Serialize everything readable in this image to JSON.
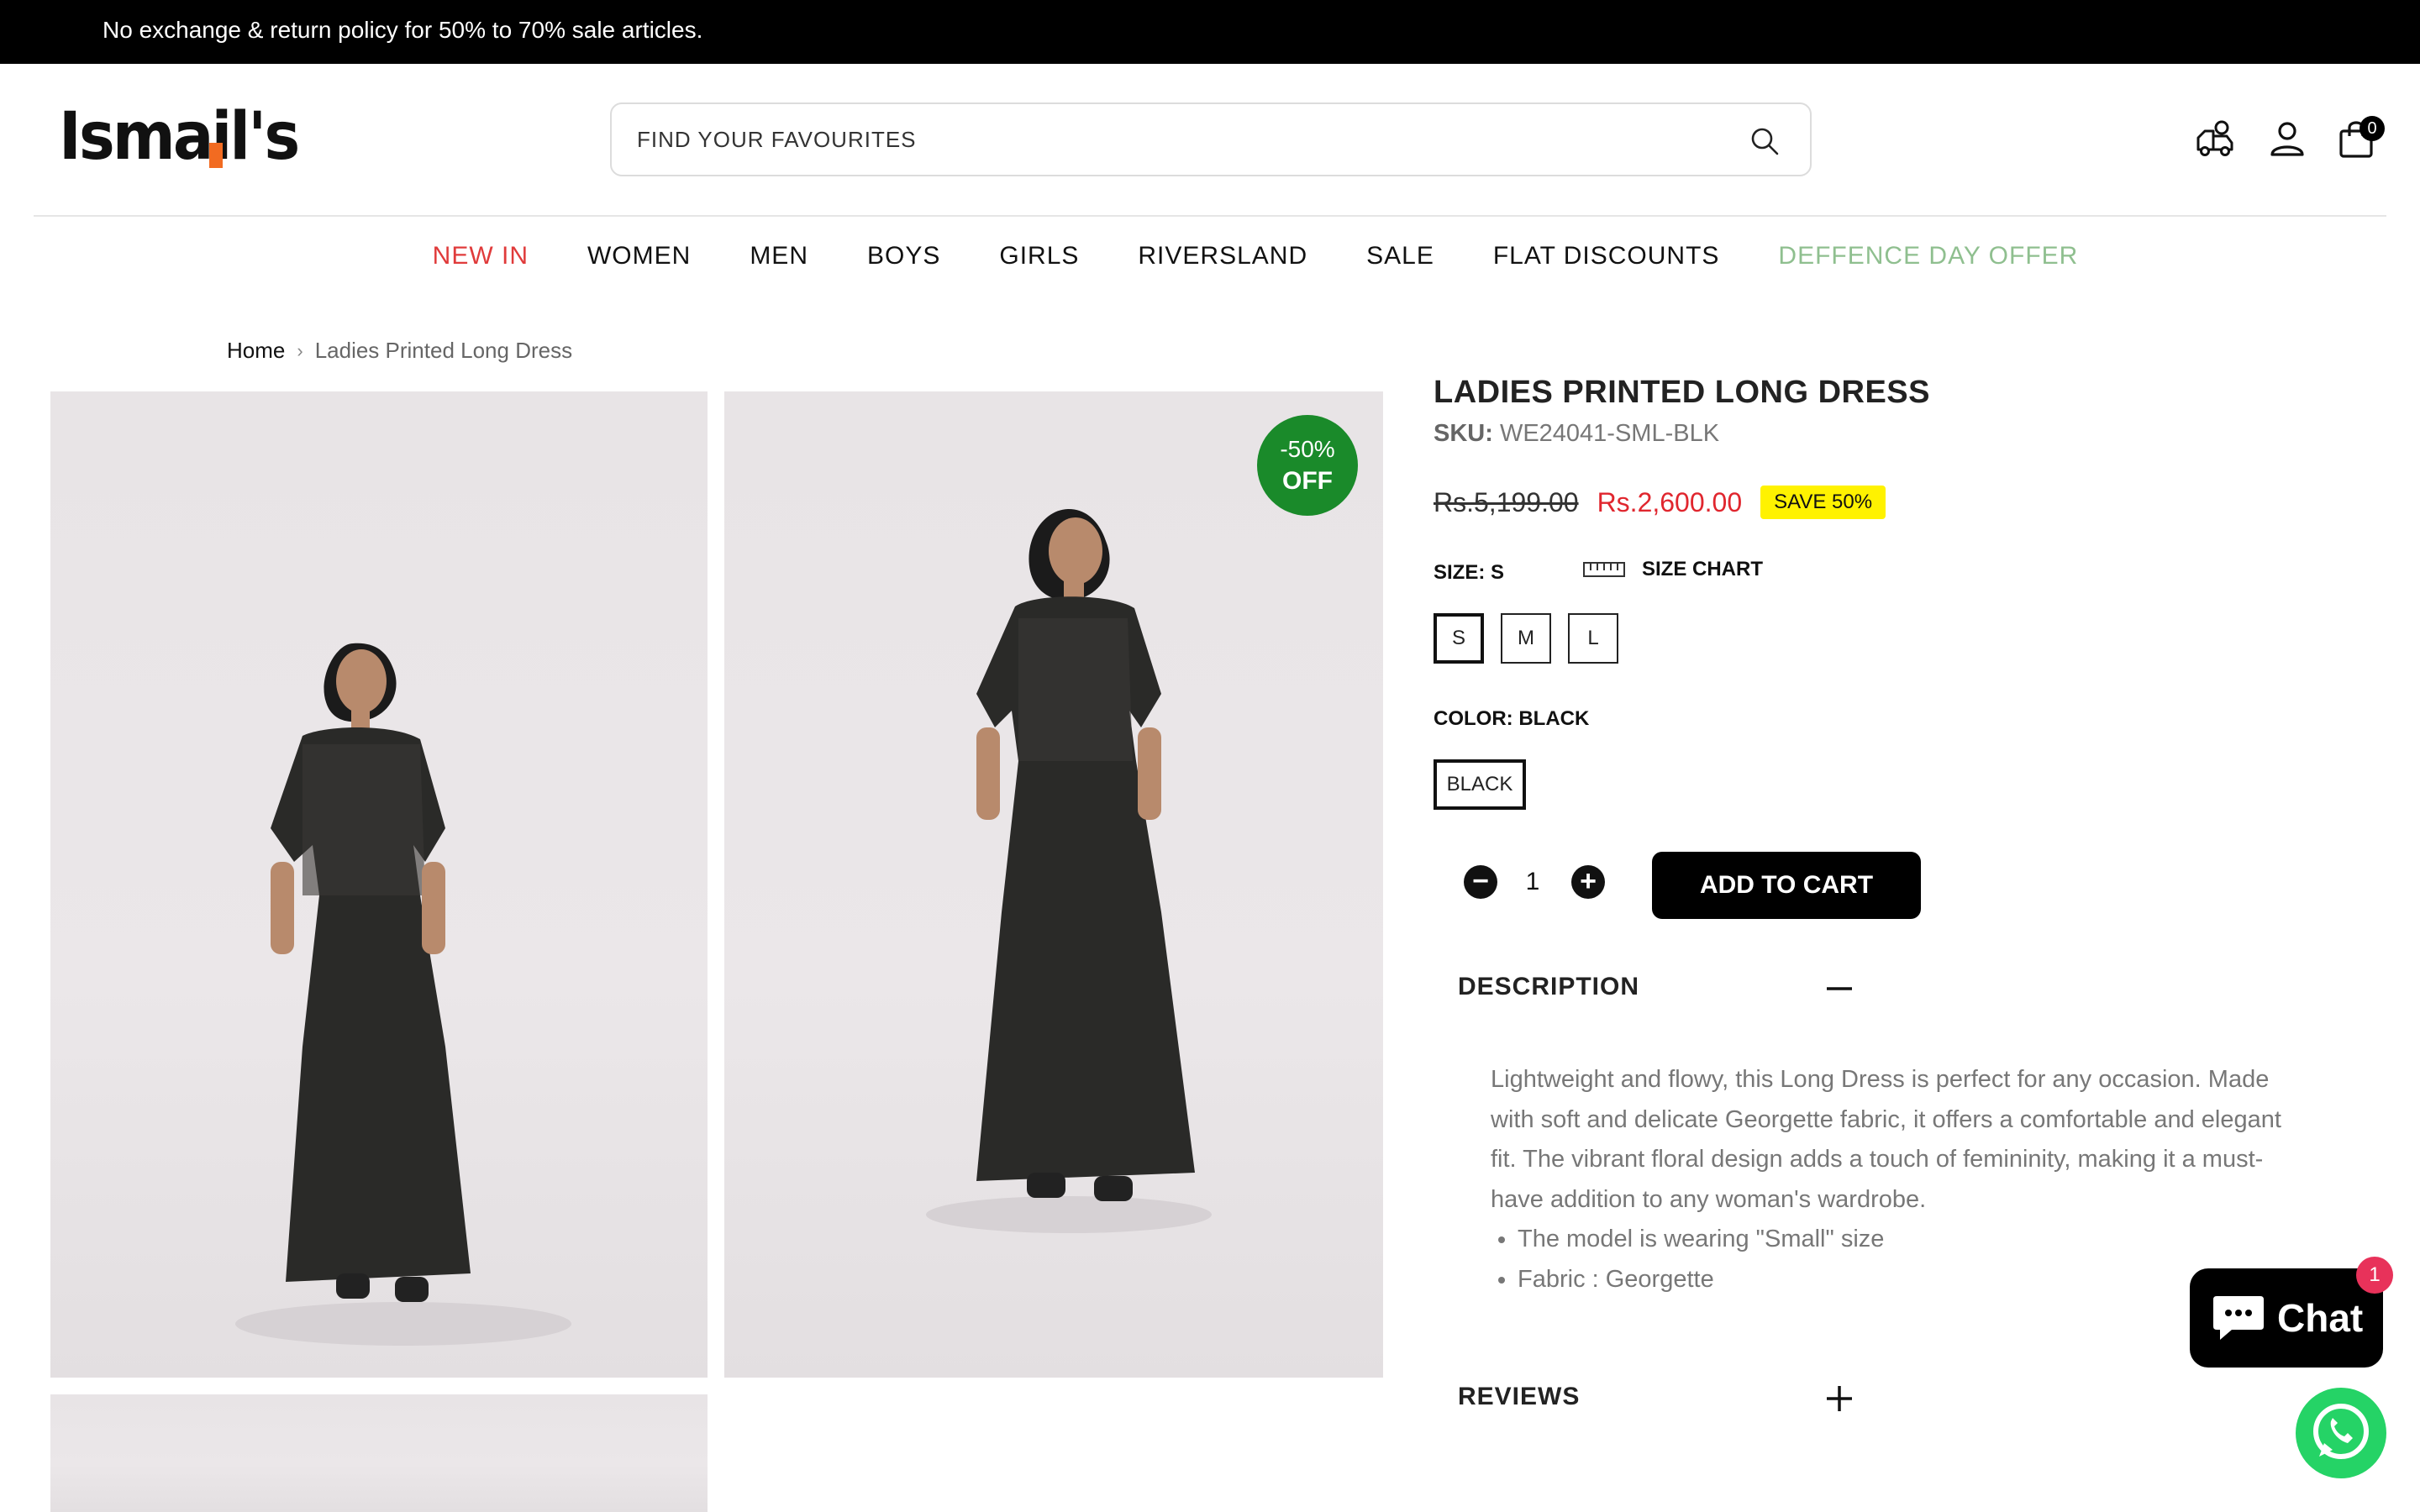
{
  "announcement": "No exchange & return policy for 50% to 70% sale articles.",
  "brand": {
    "logo_text": "Ismail's"
  },
  "search": {
    "placeholder": "FIND YOUR FAVOURITES"
  },
  "header_icons": [
    "truck-icon",
    "user-icon",
    "shopping-bag-icon"
  ],
  "cart": {
    "count": "0"
  },
  "nav": [
    {
      "label": "NEW IN",
      "color": "#e03b3b"
    },
    {
      "label": "WOMEN"
    },
    {
      "label": "MEN"
    },
    {
      "label": "BOYS"
    },
    {
      "label": "GIRLS"
    },
    {
      "label": "RIVERSLAND"
    },
    {
      "label": "SALE"
    },
    {
      "label": "FLAT DISCOUNTS"
    },
    {
      "label": "DEFFENCE DAY OFFER",
      "color": "#8fbf8f"
    }
  ],
  "breadcrumb": {
    "home": "Home",
    "current": "Ladies Printed Long Dress"
  },
  "gallery": {
    "badge_line1": "-50%",
    "badge_line2": "OFF",
    "badge_color": "#1a8a2a"
  },
  "product": {
    "title": "LADIES PRINTED LONG DRESS",
    "sku_label": "SKU:",
    "sku_value": "WE24041-SML-BLK",
    "old_price": "Rs.5,199.00",
    "new_price": "Rs.2,600.00",
    "save_label": "SAVE 50%",
    "size_label": "SIZE: S",
    "size_chart_label": "SIZE CHART",
    "sizes": [
      "S",
      "M",
      "L"
    ],
    "selected_size": "S",
    "color_label": "COLOR: BLACK",
    "colors": [
      "BLACK"
    ],
    "quantity": "1",
    "add_to_cart": "ADD TO CART"
  },
  "description": {
    "title": "DESCRIPTION",
    "text": "Lightweight and flowy, this Long Dress is perfect for any occasion. Made with soft and delicate Georgette fabric, it offers a comfortable and elegant fit. The vibrant floral design adds a touch of femininity, making it a must-have addition to any woman's wardrobe.",
    "bullets": [
      "The model is wearing \"Small\" size",
      "Fabric : Georgette"
    ]
  },
  "reviews": {
    "title": "REVIEWS"
  },
  "chat": {
    "label": "Chat",
    "badge": "1"
  },
  "colors": {
    "price_red": "#e0262e",
    "save_yellow": "#fff200",
    "whatsapp_green": "#25d366",
    "chat_badge": "#e8325a"
  }
}
